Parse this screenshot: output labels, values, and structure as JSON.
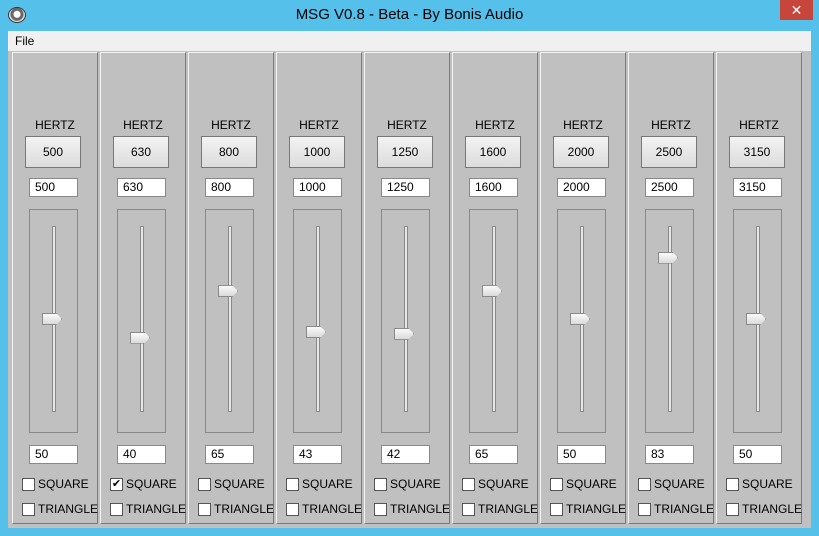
{
  "window": {
    "title": "MSG V0.8 - Beta - By Bonis Audio",
    "close_glyph": "✕",
    "icon": "speaker-icon"
  },
  "menu": {
    "file": "File"
  },
  "bands": [
    {
      "label": "HERTZ",
      "button": "500",
      "freq": "500",
      "level": "50",
      "level_value": 50,
      "square": false,
      "triangle": false,
      "square_label": "SQUARE",
      "triangle_label": "TRIANGLE"
    },
    {
      "label": "HERTZ",
      "button": "630",
      "freq": "630",
      "level": "40",
      "level_value": 40,
      "square": true,
      "triangle": false,
      "square_label": "SQUARE",
      "triangle_label": "TRIANGLE"
    },
    {
      "label": "HERTZ",
      "button": "800",
      "freq": "800",
      "level": "65",
      "level_value": 65,
      "square": false,
      "triangle": false,
      "square_label": "SQUARE",
      "triangle_label": "TRIANGLE"
    },
    {
      "label": "HERTZ",
      "button": "1000",
      "freq": "1000",
      "level": "43",
      "level_value": 43,
      "square": false,
      "triangle": false,
      "square_label": "SQUARE",
      "triangle_label": "TRIANGLE"
    },
    {
      "label": "HERTZ",
      "button": "1250",
      "freq": "1250",
      "level": "42",
      "level_value": 42,
      "square": false,
      "triangle": false,
      "square_label": "SQUARE",
      "triangle_label": "TRIANGLE"
    },
    {
      "label": "HERTZ",
      "button": "1600",
      "freq": "1600",
      "level": "65",
      "level_value": 65,
      "square": false,
      "triangle": false,
      "square_label": "SQUARE",
      "triangle_label": "TRIANGLE"
    },
    {
      "label": "HERTZ",
      "button": "2000",
      "freq": "2000",
      "level": "50",
      "level_value": 50,
      "square": false,
      "triangle": false,
      "square_label": "SQUARE",
      "triangle_label": "TRIANGLE"
    },
    {
      "label": "HERTZ",
      "button": "2500",
      "freq": "2500",
      "level": "83",
      "level_value": 83,
      "square": false,
      "triangle": false,
      "square_label": "SQUARE",
      "triangle_label": "TRIANGLE"
    },
    {
      "label": "HERTZ",
      "button": "3150",
      "freq": "3150",
      "level": "50",
      "level_value": 50,
      "square": false,
      "triangle": false,
      "square_label": "SQUARE",
      "triangle_label": "TRIANGLE"
    }
  ]
}
